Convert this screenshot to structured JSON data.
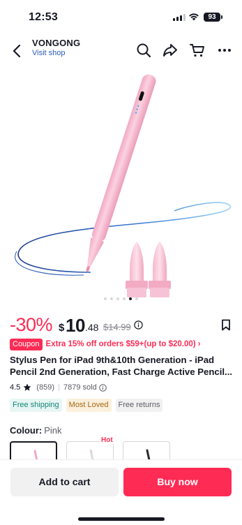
{
  "status_bar": {
    "time": "12:53",
    "battery": "93"
  },
  "header": {
    "shop_name": "VONGONG",
    "visit_shop": "Visit shop",
    "icons": [
      "back-icon",
      "search-icon",
      "share-icon",
      "cart-icon",
      "more-icon"
    ]
  },
  "gallery": {
    "current_index": 5,
    "total": 6
  },
  "price": {
    "discount": "-30%",
    "currency": "$",
    "integer": "10",
    "decimal": ".48",
    "original": "$14.99"
  },
  "coupon": {
    "tag": "Coupon",
    "text": "Extra 15% off orders $59+(up to $20.00) ›"
  },
  "product": {
    "title_line1": "Stylus Pen for iPad 9th&10th Generation - iPad",
    "title_line2": "Pencil 2nd Generation, Fast Charge Active Pencil...",
    "rating": "4.5",
    "reviews": "(859)",
    "sold": "7879 sold"
  },
  "tags": [
    "Free shipping",
    "Most Loved",
    "Free returns"
  ],
  "variants": {
    "label": "Colour:",
    "selected": "Pink",
    "hot_badge": "Hot"
  },
  "actions": {
    "add_to_cart": "Add to cart",
    "buy_now": "Buy now"
  },
  "colors": {
    "accent": "#fe2c55",
    "link": "#2b5bb8",
    "text": "#161823"
  }
}
